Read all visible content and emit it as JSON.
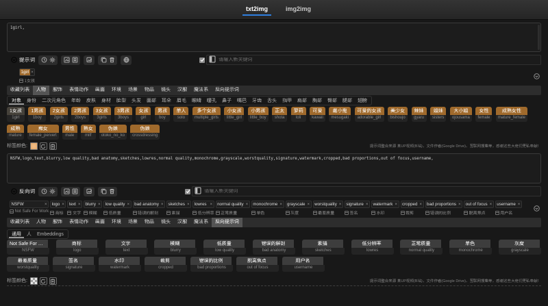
{
  "ui": {
    "remove_glyph": "×",
    "accent_blue": "#2f7fe0",
    "tag_color_positive": "#a06a2c",
    "tag_color_swatch": "#efba83"
  },
  "tabs": [
    {
      "label": "txt2img",
      "active": true
    },
    {
      "label": "img2img",
      "active": false
    }
  ],
  "positive": {
    "prompt_text": "1girl,",
    "toolbar_label": "提示词",
    "toolbar_icon_groups": [
      [
        "history",
        "settings"
      ],
      [
        "export-image",
        "save-tags"
      ],
      [
        "edit-image"
      ],
      [
        "copy",
        "trash"
      ],
      [
        "translate"
      ]
    ],
    "new_keyword_placeholder": "请输入新关键词",
    "keywords": [
      {
        "en": "1girl",
        "cn": "1女孩",
        "colored": true
      }
    ],
    "categories": [
      "收藏列表",
      "人物",
      "服饰",
      "表情动作",
      "画面",
      "环境",
      "场景",
      "物品",
      "镜头",
      "汉服",
      "魔法系",
      "反向提示词"
    ],
    "active_category": "人物",
    "subcategories": [
      "对象",
      "身份",
      "二次元角色",
      "年龄",
      "皮肤",
      "身材",
      "脸型",
      "头发",
      "面部",
      "耳朵",
      "眉毛",
      "眼睛",
      "瞳孔",
      "鼻子",
      "嘴巴",
      "牙齿",
      "舌头",
      "指甲",
      "肩部",
      "胸部",
      "臀部",
      "腿部",
      "翅膀"
    ],
    "active_subcategory": "对象",
    "tag_rows": [
      [
        {
          "cn": "1女孩",
          "en": "1girl",
          "selected": true
        },
        {
          "cn": "1男孩",
          "en": "1boy"
        },
        {
          "cn": "2女孩",
          "en": "2girls"
        },
        {
          "cn": "2男孩",
          "en": "2boys"
        },
        {
          "cn": "3女孩",
          "en": "3girls"
        },
        {
          "cn": "3男孩",
          "en": "3boys"
        },
        {
          "cn": "女孩",
          "en": "girl"
        },
        {
          "cn": "男孩",
          "en": "boy"
        },
        {
          "cn": "单人",
          "en": "solo"
        },
        {
          "cn": "多个女孩",
          "en": "multiple_girls"
        },
        {
          "cn": "小女孩",
          "en": "little_girl"
        },
        {
          "cn": "小男孩",
          "en": "little_boy"
        },
        {
          "cn": "正太",
          "en": "shota"
        },
        {
          "cn": "萝莉",
          "en": "loli"
        },
        {
          "cn": "可爱",
          "en": "kawaii"
        },
        {
          "cn": "雌小鬼",
          "en": "mesugaki"
        },
        {
          "cn": "可爱的女孩",
          "en": "adorable_girl"
        },
        {
          "cn": "美少女",
          "en": "bishoujo"
        },
        {
          "cn": "辣妹",
          "en": "gyaru"
        },
        {
          "cn": "姐妹",
          "en": "sisters"
        },
        {
          "cn": "大小姐",
          "en": "ojousama"
        },
        {
          "cn": "女性",
          "en": "female"
        },
        {
          "cn": "成熟女性",
          "en": "mature_female"
        }
      ],
      [
        {
          "cn": "成熟",
          "en": "mature"
        },
        {
          "cn": "痴女",
          "en": "female_pervert"
        },
        {
          "cn": "男性",
          "en": "male"
        },
        {
          "cn": "熟女",
          "en": "milf"
        },
        {
          "cn": "伪娘",
          "en": "otoko_no_ko"
        },
        {
          "cn": "伪娘",
          "en": "crossdressing"
        }
      ]
    ],
    "tag_color_label": "标签颜色:",
    "footer_note": "提示词整合来源 某UP视频(B站)，文件作者(Google Drive)、互联网搜集等，感谢这些大佬们无私奉献！"
  },
  "negative": {
    "prompt_text": "NSFW,logo,text,blurry,low quality,bad anatomy,sketches,lowres,normal quality,monochrome,grayscale,worstquality,signature,watermark,cropped,bad proportions,out of focus,username,",
    "toolbar_label": "反向词",
    "toolbar_icon_groups": [
      [
        "history",
        "settings"
      ],
      [
        "export-image",
        "save-tags"
      ],
      [
        "edit-image"
      ],
      [
        "copy",
        "trash"
      ]
    ],
    "new_keyword_placeholder": "请输入新关键词",
    "keywords": [
      {
        "en": "NSFW",
        "cn": "Not Safe For Work"
      },
      {
        "en": "logo",
        "cn": "商标"
      },
      {
        "en": "text",
        "cn": "文字"
      },
      {
        "en": "blurry",
        "cn": "模糊"
      },
      {
        "en": "low quality",
        "cn": "低质量"
      },
      {
        "en": "bad anatomy",
        "cn": "错误的解剖"
      },
      {
        "en": "sketches",
        "cn": "素描"
      },
      {
        "en": "lowres",
        "cn": "低分辨率"
      },
      {
        "en": "normal quality",
        "cn": "正常质量"
      },
      {
        "en": "monochrome",
        "cn": "单色"
      },
      {
        "en": "grayscale",
        "cn": "灰度"
      },
      {
        "en": "worstquality",
        "cn": "最差质量"
      },
      {
        "en": "signature",
        "cn": "签名"
      },
      {
        "en": "watermark",
        "cn": "水印"
      },
      {
        "en": "cropped",
        "cn": "裁剪"
      },
      {
        "en": "bad proportions",
        "cn": "错误的比例"
      },
      {
        "en": "out of focus",
        "cn": "脱离焦点"
      },
      {
        "en": "username",
        "cn": "用户名"
      }
    ],
    "categories": [
      "收藏列表",
      "人物",
      "服饰",
      "表情动作",
      "画面",
      "环境",
      "场景",
      "物品",
      "镜头",
      "汉服",
      "魔法系",
      "反向提示词"
    ],
    "active_category": "反向提示词",
    "subcategories": [
      "通用",
      "人",
      "Embeddings"
    ],
    "active_subcategory": "通用",
    "tag_rows": [
      [
        {
          "cn": "Not Safe For Work",
          "en": "NSFW",
          "selected": true
        },
        {
          "cn": "商标",
          "en": "logo",
          "selected": true
        },
        {
          "cn": "文字",
          "en": "text",
          "selected": true
        },
        {
          "cn": "模糊",
          "en": "blurry",
          "selected": true
        },
        {
          "cn": "低质量",
          "en": "low quality",
          "selected": true
        },
        {
          "cn": "错误的解剖",
          "en": "bad anatomy",
          "selected": true
        },
        {
          "cn": "素描",
          "en": "sketches",
          "selected": true
        },
        {
          "cn": "低分辨率",
          "en": "lowres",
          "selected": true
        },
        {
          "cn": "正常质量",
          "en": "normal quality",
          "selected": true
        },
        {
          "cn": "单色",
          "en": "monochrome",
          "selected": true
        },
        {
          "cn": "灰度",
          "en": "grayscale",
          "selected": true
        }
      ],
      [
        {
          "cn": "最差质量",
          "en": "worstquality",
          "selected": true
        },
        {
          "cn": "签名",
          "en": "signature",
          "selected": true
        },
        {
          "cn": "水印",
          "en": "watermark",
          "selected": true
        },
        {
          "cn": "裁剪",
          "en": "cropped",
          "selected": true
        },
        {
          "cn": "错误的比例",
          "en": "bad proportions",
          "selected": true
        },
        {
          "cn": "脱离焦点",
          "en": "out of focus",
          "selected": true
        },
        {
          "cn": "用户名",
          "en": "username",
          "selected": true
        }
      ]
    ],
    "tag_color_label": "标签颜色:",
    "footer_note": "提示词整合来源 某UP视频(B站)，文件作者(Google Drive)、互联网搜集等，感谢这些大佬们无私奉献！"
  }
}
